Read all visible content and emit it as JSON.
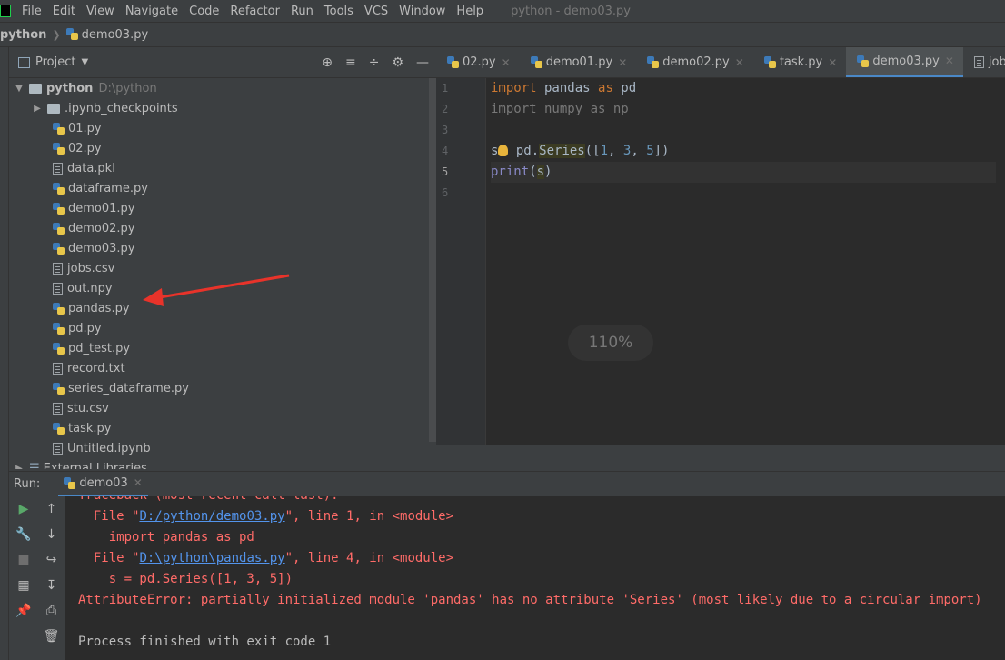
{
  "menubar": {
    "items": [
      "File",
      "Edit",
      "View",
      "Navigate",
      "Code",
      "Refactor",
      "Run",
      "Tools",
      "VCS",
      "Window",
      "Help"
    ],
    "window_title": "python - demo03.py"
  },
  "navbar": {
    "root": "python",
    "file": "demo03.py"
  },
  "project": {
    "title": "Project",
    "root_name": "python",
    "root_path": "D:\\python",
    "items": [
      {
        "name": ".ipynb_checkpoints",
        "kind": "folder"
      },
      {
        "name": "01.py",
        "kind": "py"
      },
      {
        "name": "02.py",
        "kind": "py"
      },
      {
        "name": "data.pkl",
        "kind": "file"
      },
      {
        "name": "dataframe.py",
        "kind": "py"
      },
      {
        "name": "demo01.py",
        "kind": "py"
      },
      {
        "name": "demo02.py",
        "kind": "py"
      },
      {
        "name": "demo03.py",
        "kind": "py"
      },
      {
        "name": "jobs.csv",
        "kind": "file"
      },
      {
        "name": "out.npy",
        "kind": "file"
      },
      {
        "name": "pandas.py",
        "kind": "py"
      },
      {
        "name": "pd.py",
        "kind": "py"
      },
      {
        "name": "pd_test.py",
        "kind": "py"
      },
      {
        "name": "record.txt",
        "kind": "file"
      },
      {
        "name": "series_dataframe.py",
        "kind": "py"
      },
      {
        "name": "stu.csv",
        "kind": "file"
      },
      {
        "name": "task.py",
        "kind": "py"
      },
      {
        "name": "Untitled.ipynb",
        "kind": "file"
      }
    ],
    "external": "External Libraries"
  },
  "editor": {
    "tabs": [
      "02.py",
      "demo01.py",
      "demo02.py",
      "task.py",
      "demo03.py",
      "jobs"
    ],
    "active_tab": "demo03.py",
    "line_numbers": [
      "1",
      "2",
      "3",
      "4",
      "5",
      "6"
    ],
    "zoom": "110%"
  },
  "run": {
    "label": "Run:",
    "tab": "demo03",
    "console": {
      "traceback": "Traceback (most recent call last):",
      "file1_prefix": "  File \"",
      "file1_link": "D:/python/demo03.py",
      "file1_suffix": "\", line 1, in <module>",
      "code1": "    import pandas as pd",
      "file2_prefix": "  File \"",
      "file2_link": "D:\\python\\pandas.py",
      "file2_suffix": "\", line 4, in <module>",
      "code2": "    s = pd.Series([1, 3, 5])",
      "error": "AttributeError: partially initialized module 'pandas' has no attribute 'Series' (most likely due to a circular import)",
      "blank": "",
      "exit": "Process finished with exit code 1"
    }
  },
  "colors": {
    "annotation_arrow": "#e8332a",
    "error_text": "#ff6b68",
    "link": "#5394ec"
  }
}
